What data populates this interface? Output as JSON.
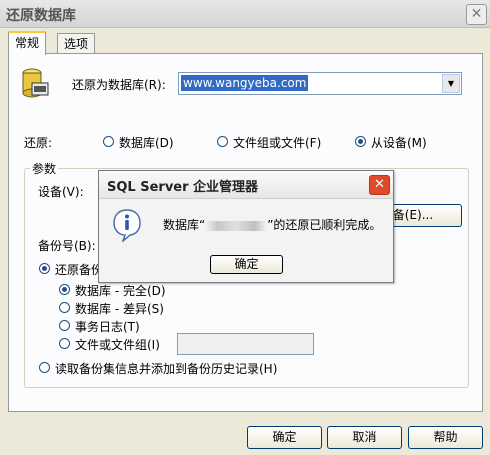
{
  "window": {
    "title": "还原数据库",
    "close_glyph": "✕"
  },
  "tabs": [
    {
      "label": "常规"
    },
    {
      "label": "选项"
    }
  ],
  "restore_as": {
    "label": "还原为数据库(R):",
    "value": "www.wangyeba.com"
  },
  "restore": {
    "label": "还原:",
    "options": [
      {
        "label": "数据库(D)",
        "checked": false
      },
      {
        "label": "文件组或文件(F)",
        "checked": false
      },
      {
        "label": "从设备(M)",
        "checked": true
      }
    ]
  },
  "params": {
    "label": "参数",
    "device_label": "设备(V):",
    "select_device_button": "择设备(E)...",
    "backup_number_label": "备份号(B):",
    "restore_backup_label": "还原备份",
    "backup_types": [
      {
        "label": "数据库 - 完全(D)",
        "checked": true
      },
      {
        "label": "数据库 - 差异(S)",
        "checked": false
      },
      {
        "label": "事务日志(T)",
        "checked": false
      },
      {
        "label": "文件或文件组(I)",
        "checked": false
      }
    ],
    "read_backup_label": "读取备份集信息并添加到备份历史记录(H)"
  },
  "footer": {
    "ok": "确定",
    "cancel": "取消",
    "help": "帮助"
  },
  "dialog": {
    "title": "SQL Server 企业管理器",
    "message_prefix": "数据库“",
    "message_suffix": "”的还原已顺利完成。",
    "ok": "确定",
    "close_glyph": "✕",
    "icon": "info-icon"
  }
}
